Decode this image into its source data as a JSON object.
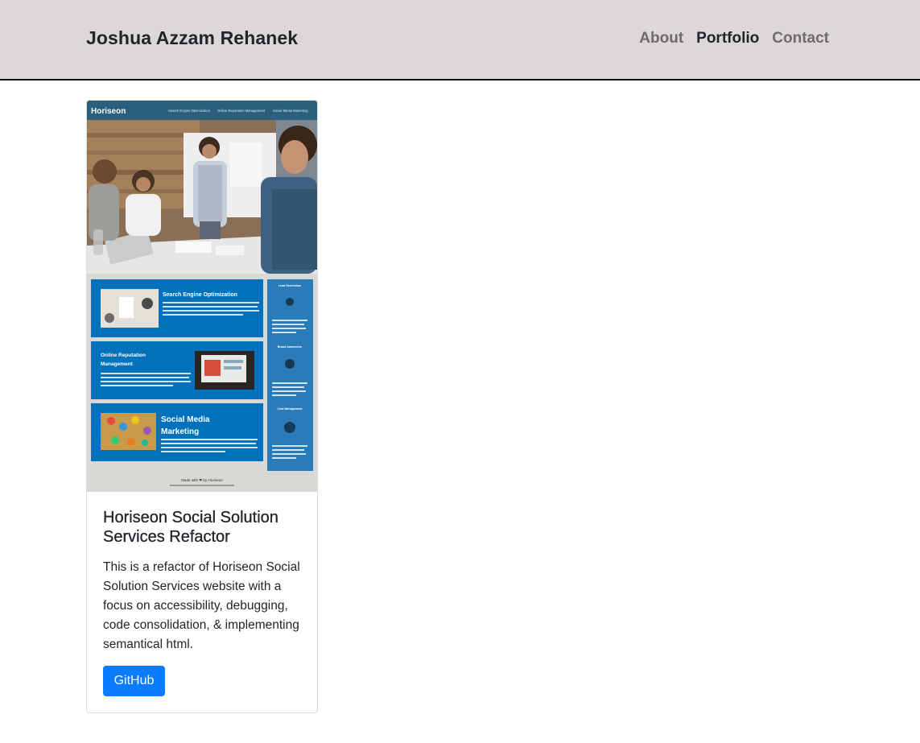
{
  "header": {
    "brand": "Joshua Azzam Rehanek",
    "nav": [
      {
        "label": "About"
      },
      {
        "label": "Portfolio"
      },
      {
        "label": "Contact"
      }
    ]
  },
  "project": {
    "thumbnail": {
      "site_logo": "Horiseon",
      "site_nav": [
        "Search Engine Optimization",
        "Online Reputation Management",
        "Social Media Marketing"
      ],
      "sections": [
        "Search Engine Optimization",
        "Online Reputation Management",
        "Social Media Marketing"
      ],
      "sidebar": [
        "Lead Generation",
        "Brand Awareness",
        "Cost Management"
      ],
      "footer": "Made with ❤ by Horiseon"
    },
    "title": "Horiseon Social Solution Services Refactor",
    "description": "This is a refactor of Horiseon Social Solution Services website with a focus on accessibility, debugging, code consolidation, & implementing semantical html.",
    "button_label": "GitHub"
  },
  "colors": {
    "header_bg": "#dcd7d8",
    "button_bg": "#0b7bff",
    "thumb_blue": "#0072bb",
    "thumb_header": "#2a607c"
  }
}
